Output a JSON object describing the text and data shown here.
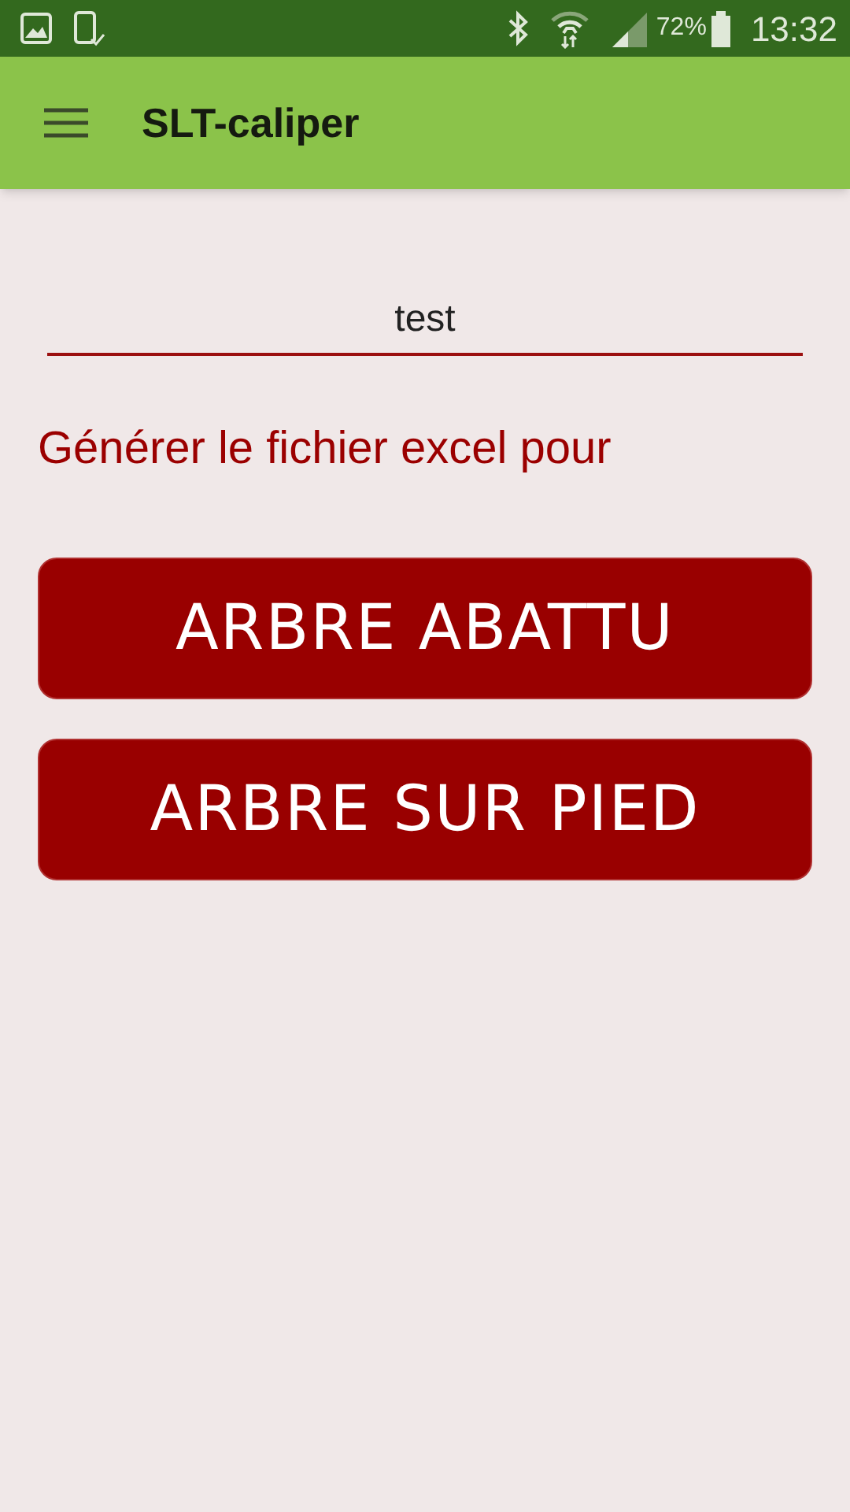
{
  "status_bar": {
    "battery": "72%",
    "time": "13:32"
  },
  "app_bar": {
    "title": "SLT-caliper"
  },
  "name_field": {
    "value": "test"
  },
  "prompt": "Générer le fichier excel pour",
  "buttons": [
    "ARBRE ABATTU",
    "ARBRE SUR PIED"
  ]
}
